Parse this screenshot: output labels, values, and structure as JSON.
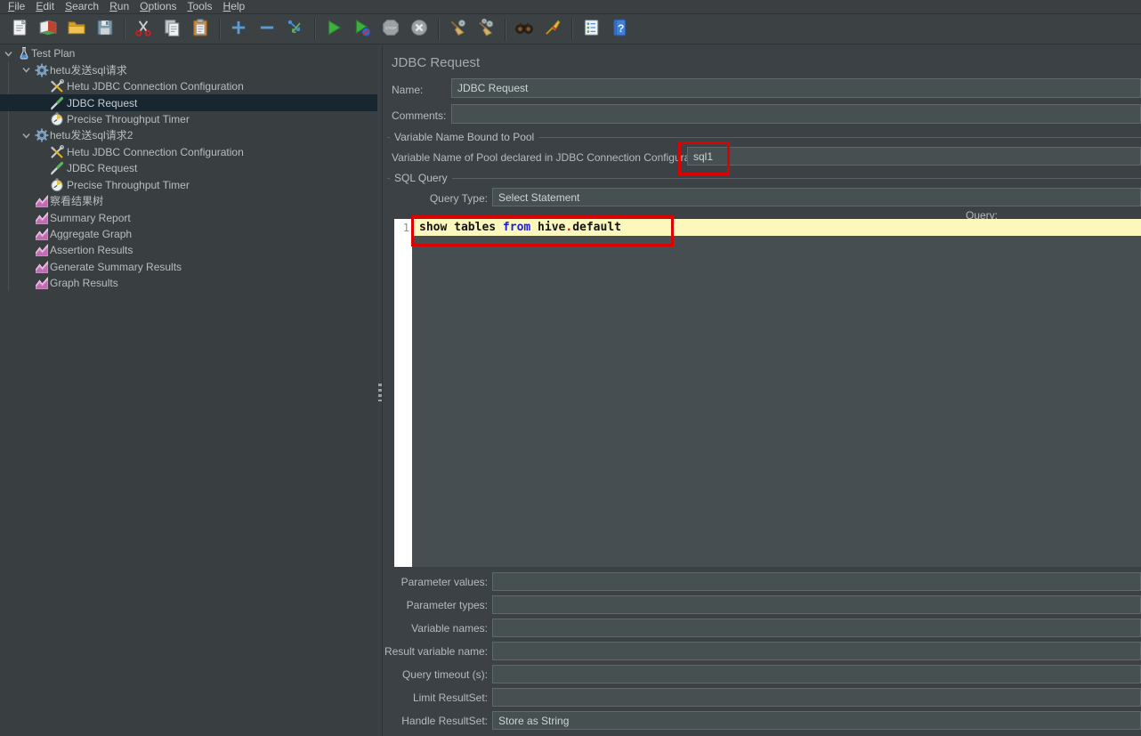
{
  "colors": {
    "selection_bg": "#18262f",
    "annotation_red": "#dd0202",
    "current_line_yellow": "#fbf7bd",
    "keyword_blue": "#1d1dd6",
    "dot_red": "#cc1414",
    "gutter_white": "#ffffff"
  },
  "menu": {
    "items": [
      "File",
      "Edit",
      "Search",
      "Run",
      "Options",
      "Tools",
      "Help"
    ]
  },
  "toolbar": {
    "icons": [
      "new",
      "templates",
      "open",
      "save",
      "|",
      "cut",
      "copy",
      "paste",
      "|",
      "add",
      "remove",
      "reset",
      "|",
      "start",
      "start-no-pauses",
      "stop",
      "shutdown",
      "|",
      "clear",
      "clear-all",
      "|",
      "search",
      "clear-search",
      "|",
      "function-helper",
      "help"
    ]
  },
  "tree": {
    "items": [
      {
        "name": "test-plan",
        "label": "Test Plan",
        "icon": "test-plan",
        "level": 0,
        "expanded": true
      },
      {
        "name": "thread-group-hetu-1",
        "label": "hetu发送sql请求",
        "icon": "thread-group",
        "level": 1,
        "expanded": true
      },
      {
        "name": "jdbc-connection-config-1",
        "label": "Hetu JDBC Connection Configuration",
        "icon": "jdbc-config",
        "level": 2
      },
      {
        "name": "jdbc-request-1",
        "label": "JDBC Request",
        "icon": "jdbc-request",
        "level": 2,
        "selected": true
      },
      {
        "name": "precise-throughput-timer-1",
        "label": "Precise Throughput Timer",
        "icon": "timer",
        "level": 2
      },
      {
        "name": "thread-group-hetu-2",
        "label": "hetu发送sql请求2",
        "icon": "thread-group",
        "level": 1,
        "expanded": true
      },
      {
        "name": "jdbc-connection-config-2",
        "label": "Hetu JDBC Connection Configuration",
        "icon": "jdbc-config",
        "level": 2
      },
      {
        "name": "jdbc-request-2",
        "label": "JDBC Request",
        "icon": "jdbc-request",
        "level": 2
      },
      {
        "name": "precise-throughput-timer-2",
        "label": "Precise Throughput Timer",
        "icon": "timer",
        "level": 2
      },
      {
        "name": "view-results-tree",
        "label": "察看结果树",
        "icon": "listener",
        "level": 1
      },
      {
        "name": "summary-report",
        "label": "Summary Report",
        "icon": "listener",
        "level": 1
      },
      {
        "name": "aggregate-graph",
        "label": "Aggregate Graph",
        "icon": "listener",
        "level": 1
      },
      {
        "name": "assertion-results",
        "label": "Assertion Results",
        "icon": "listener",
        "level": 1
      },
      {
        "name": "generate-summary-results",
        "label": "Generate Summary Results",
        "icon": "listener",
        "level": 1
      },
      {
        "name": "graph-results",
        "label": "Graph Results",
        "icon": "listener",
        "level": 1
      }
    ]
  },
  "panel": {
    "title": "JDBC Request",
    "name_label": "Name:",
    "name_value": "JDBC Request",
    "comments_label": "Comments:",
    "comments_value": "",
    "group_pool_title": "Variable Name Bound to Pool",
    "pool_label": "Variable Name of Pool declared in JDBC Connection Configuration:",
    "pool_value": "sql1",
    "group_sql_title": "SQL Query",
    "query_type_label": "Query Type:",
    "query_type_value": "Select Statement",
    "query_label": "Query:",
    "editor": {
      "line_number": "1",
      "code_parts": [
        {
          "text": "show tables ",
          "style": "plain"
        },
        {
          "text": "from",
          "style": "keyword"
        },
        {
          "text": " hive",
          "style": "plain"
        },
        {
          "text": ".",
          "style": "dot"
        },
        {
          "text": "default",
          "style": "plain"
        }
      ]
    },
    "fields": [
      {
        "name": "parameter-values",
        "label": "Parameter values:",
        "value": ""
      },
      {
        "name": "parameter-types",
        "label": "Parameter types:",
        "value": ""
      },
      {
        "name": "variable-names",
        "label": "Variable names:",
        "value": ""
      },
      {
        "name": "result-variable-name",
        "label": "Result variable name:",
        "value": ""
      },
      {
        "name": "query-timeout",
        "label": "Query timeout (s):",
        "value": ""
      },
      {
        "name": "limit-resultset",
        "label": "Limit ResultSet:",
        "value": ""
      },
      {
        "name": "handle-resultset",
        "label": "Handle ResultSet:",
        "value": "Store as String"
      }
    ]
  }
}
